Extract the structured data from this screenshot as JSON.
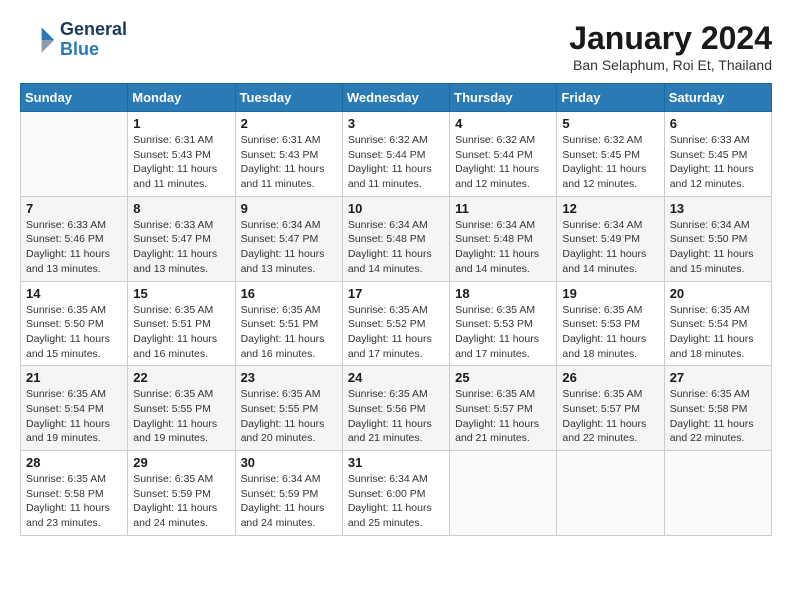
{
  "header": {
    "logo_line1": "General",
    "logo_line2": "Blue",
    "month": "January 2024",
    "location": "Ban Selaphum, Roi Et, Thailand"
  },
  "weekdays": [
    "Sunday",
    "Monday",
    "Tuesday",
    "Wednesday",
    "Thursday",
    "Friday",
    "Saturday"
  ],
  "weeks": [
    [
      {
        "day": "",
        "info": ""
      },
      {
        "day": "1",
        "info": "Sunrise: 6:31 AM\nSunset: 5:43 PM\nDaylight: 11 hours\nand 11 minutes."
      },
      {
        "day": "2",
        "info": "Sunrise: 6:31 AM\nSunset: 5:43 PM\nDaylight: 11 hours\nand 11 minutes."
      },
      {
        "day": "3",
        "info": "Sunrise: 6:32 AM\nSunset: 5:44 PM\nDaylight: 11 hours\nand 11 minutes."
      },
      {
        "day": "4",
        "info": "Sunrise: 6:32 AM\nSunset: 5:44 PM\nDaylight: 11 hours\nand 12 minutes."
      },
      {
        "day": "5",
        "info": "Sunrise: 6:32 AM\nSunset: 5:45 PM\nDaylight: 11 hours\nand 12 minutes."
      },
      {
        "day": "6",
        "info": "Sunrise: 6:33 AM\nSunset: 5:45 PM\nDaylight: 11 hours\nand 12 minutes."
      }
    ],
    [
      {
        "day": "7",
        "info": "Sunrise: 6:33 AM\nSunset: 5:46 PM\nDaylight: 11 hours\nand 13 minutes."
      },
      {
        "day": "8",
        "info": "Sunrise: 6:33 AM\nSunset: 5:47 PM\nDaylight: 11 hours\nand 13 minutes."
      },
      {
        "day": "9",
        "info": "Sunrise: 6:34 AM\nSunset: 5:47 PM\nDaylight: 11 hours\nand 13 minutes."
      },
      {
        "day": "10",
        "info": "Sunrise: 6:34 AM\nSunset: 5:48 PM\nDaylight: 11 hours\nand 14 minutes."
      },
      {
        "day": "11",
        "info": "Sunrise: 6:34 AM\nSunset: 5:48 PM\nDaylight: 11 hours\nand 14 minutes."
      },
      {
        "day": "12",
        "info": "Sunrise: 6:34 AM\nSunset: 5:49 PM\nDaylight: 11 hours\nand 14 minutes."
      },
      {
        "day": "13",
        "info": "Sunrise: 6:34 AM\nSunset: 5:50 PM\nDaylight: 11 hours\nand 15 minutes."
      }
    ],
    [
      {
        "day": "14",
        "info": "Sunrise: 6:35 AM\nSunset: 5:50 PM\nDaylight: 11 hours\nand 15 minutes."
      },
      {
        "day": "15",
        "info": "Sunrise: 6:35 AM\nSunset: 5:51 PM\nDaylight: 11 hours\nand 16 minutes."
      },
      {
        "day": "16",
        "info": "Sunrise: 6:35 AM\nSunset: 5:51 PM\nDaylight: 11 hours\nand 16 minutes."
      },
      {
        "day": "17",
        "info": "Sunrise: 6:35 AM\nSunset: 5:52 PM\nDaylight: 11 hours\nand 17 minutes."
      },
      {
        "day": "18",
        "info": "Sunrise: 6:35 AM\nSunset: 5:53 PM\nDaylight: 11 hours\nand 17 minutes."
      },
      {
        "day": "19",
        "info": "Sunrise: 6:35 AM\nSunset: 5:53 PM\nDaylight: 11 hours\nand 18 minutes."
      },
      {
        "day": "20",
        "info": "Sunrise: 6:35 AM\nSunset: 5:54 PM\nDaylight: 11 hours\nand 18 minutes."
      }
    ],
    [
      {
        "day": "21",
        "info": "Sunrise: 6:35 AM\nSunset: 5:54 PM\nDaylight: 11 hours\nand 19 minutes."
      },
      {
        "day": "22",
        "info": "Sunrise: 6:35 AM\nSunset: 5:55 PM\nDaylight: 11 hours\nand 19 minutes."
      },
      {
        "day": "23",
        "info": "Sunrise: 6:35 AM\nSunset: 5:55 PM\nDaylight: 11 hours\nand 20 minutes."
      },
      {
        "day": "24",
        "info": "Sunrise: 6:35 AM\nSunset: 5:56 PM\nDaylight: 11 hours\nand 21 minutes."
      },
      {
        "day": "25",
        "info": "Sunrise: 6:35 AM\nSunset: 5:57 PM\nDaylight: 11 hours\nand 21 minutes."
      },
      {
        "day": "26",
        "info": "Sunrise: 6:35 AM\nSunset: 5:57 PM\nDaylight: 11 hours\nand 22 minutes."
      },
      {
        "day": "27",
        "info": "Sunrise: 6:35 AM\nSunset: 5:58 PM\nDaylight: 11 hours\nand 22 minutes."
      }
    ],
    [
      {
        "day": "28",
        "info": "Sunrise: 6:35 AM\nSunset: 5:58 PM\nDaylight: 11 hours\nand 23 minutes."
      },
      {
        "day": "29",
        "info": "Sunrise: 6:35 AM\nSunset: 5:59 PM\nDaylight: 11 hours\nand 24 minutes."
      },
      {
        "day": "30",
        "info": "Sunrise: 6:34 AM\nSunset: 5:59 PM\nDaylight: 11 hours\nand 24 minutes."
      },
      {
        "day": "31",
        "info": "Sunrise: 6:34 AM\nSunset: 6:00 PM\nDaylight: 11 hours\nand 25 minutes."
      },
      {
        "day": "",
        "info": ""
      },
      {
        "day": "",
        "info": ""
      },
      {
        "day": "",
        "info": ""
      }
    ]
  ]
}
